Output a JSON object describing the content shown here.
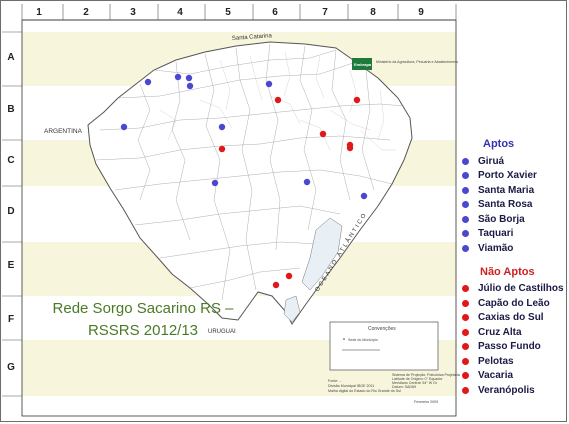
{
  "columns": [
    "1",
    "2",
    "3",
    "4",
    "5",
    "6",
    "7",
    "8",
    "9"
  ],
  "rows": [
    "A",
    "B",
    "C",
    "D",
    "E",
    "F",
    "G"
  ],
  "geo_labels": {
    "argentina": "ARGENTINA",
    "uruguai": "URUGUAI",
    "santa_catarina": "Santa Catarina",
    "oceano": "OCEANO ATLÂNTICO"
  },
  "logo": {
    "brand": "Embrapa",
    "ministry": "Ministério da Agricultura, Pecuária e Abastecimento"
  },
  "map_title": {
    "line1": "Rede Sorgo Sacarino RS –",
    "line2": "RSSRS  2012/13"
  },
  "conventions_box": {
    "title": "Convenções",
    "item": "Sede do Município",
    "proj_lines": [
      "Sistema de Projeção: Policônica Projetada",
      "Latitude de Origem: 0° Equador",
      "Meridiano Central: 54° W Gr",
      "Datum: SAD69"
    ],
    "source_lines": [
      "Fonte: ...",
      "Divisão Municipal IBGE 2011",
      "Malha digital do Estado do Rio Grande do Sul"
    ],
    "footer": "Fevereiro 2009"
  },
  "colors": {
    "apto": "#4a48d0",
    "nao_apto": "#e01818",
    "title": "#4b7a27",
    "band": "#f7f6dc"
  },
  "legend": {
    "aptos_title": "Aptos",
    "aptos": [
      "Giruá",
      "Porto Xavier",
      "Santa Maria",
      "Santa Rosa",
      "São Borja",
      "Taquari",
      "Viamão"
    ],
    "nao_aptos_title": "Não Aptos",
    "nao_aptos": [
      "Júlio de Castilhos",
      "Capão do Leão",
      "Caxias do Sul",
      "Cruz Alta",
      "Passo Fundo",
      "Pelotas",
      "Vacaria",
      "Veranópolis"
    ]
  },
  "point_count": {
    "apto": 10,
    "nao_apto": 8
  }
}
